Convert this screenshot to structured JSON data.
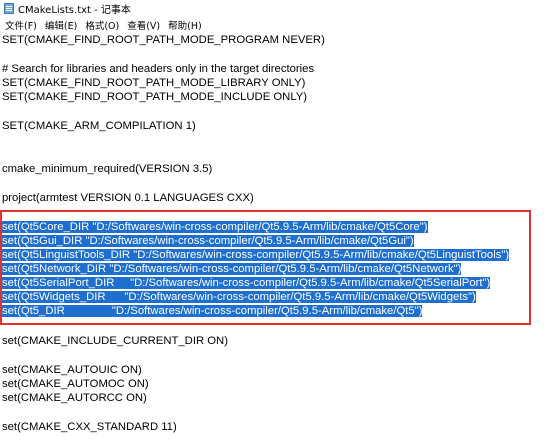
{
  "window": {
    "title": "CMakeLists.txt - 记事本"
  },
  "menu": [
    {
      "label": "文件(F)"
    },
    {
      "label": "编辑(E)"
    },
    {
      "label": "格式(O)"
    },
    {
      "label": "查看(V)"
    },
    {
      "label": "帮助(H)"
    }
  ],
  "editor": {
    "lines": [
      "SET(CMAKE_FIND_ROOT_PATH_MODE_PROGRAM NEVER)",
      "# Search for libraries and headers only in the target directories",
      "SET(CMAKE_FIND_ROOT_PATH_MODE_LIBRARY ONLY)",
      "SET(CMAKE_FIND_ROOT_PATH_MODE_INCLUDE ONLY)",
      "SET(CMAKE_ARM_COMPILATION 1)",
      "cmake_minimum_required(VERSION 3.5)",
      "project(armtest VERSION 0.1 LANGUAGES CXX)",
      "set(Qt5Core_DIR \"D:/Softwares/win-cross-compiler/Qt5.9.5-Arm/lib/cmake/Qt5Core\")",
      "set(Qt5Gui_DIR \"D:/Softwares/win-cross-compiler/Qt5.9.5-Arm/lib/cmake/Qt5Gui\")",
      "set(Qt5LinguistTools_DIR \"D:/Softwares/win-cross-compiler/Qt5.9.5-Arm/lib/cmake/Qt5LinguistTools\")",
      "set(Qt5Network_DIR \"D:/Softwares/win-cross-compiler/Qt5.9.5-Arm/lib/cmake/Qt5Network\")",
      "set(Qt5SerialPort_DIR     \"D:/Softwares/win-cross-compiler/Qt5.9.5-Arm/lib/cmake/Qt5SerialPort\")",
      "set(Qt5Widgets_DIR      \"D:/Softwares/win-cross-compiler/Qt5.9.5-Arm/lib/cmake/Qt5Widgets\")",
      "set(Qt5_DIR               \"D:/Softwares/win-cross-compiler/Qt5.9.5-Arm/lib/cmake/Qt5\")",
      "set(CMAKE_INCLUDE_CURRENT_DIR ON)",
      "set(CMAKE_AUTOUIC ON)",
      "set(CMAKE_AUTOMOC ON)",
      "set(CMAKE_AUTORCC ON)",
      "set(CMAKE_CXX_STANDARD 11)"
    ]
  },
  "colors": {
    "selection": "#1f6fd0",
    "annotation_box": "#e33232"
  }
}
